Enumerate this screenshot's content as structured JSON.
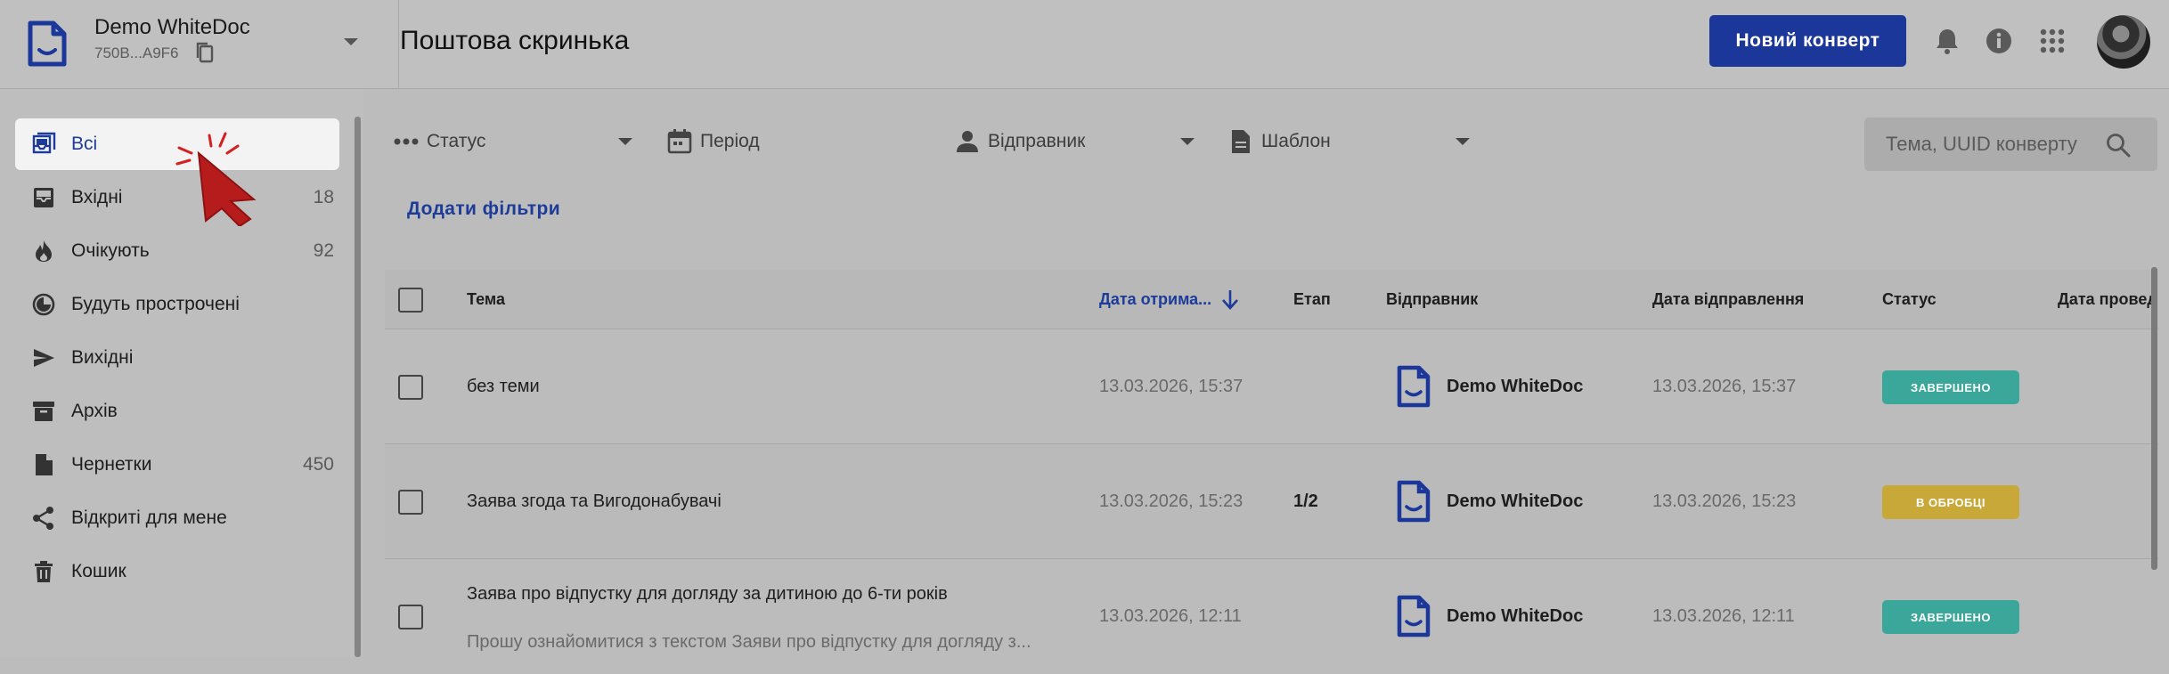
{
  "header": {
    "org_name": "Demo WhiteDoc",
    "org_id": "750B...A9F6",
    "page_title": "Поштова скринька",
    "new_envelope_label": "Новий конверт"
  },
  "colors": {
    "brand": "#1a3799",
    "status_done": "#3aa79a",
    "status_processing": "#c9a83a"
  },
  "sidebar": {
    "items": [
      {
        "label": "Всі",
        "count": "",
        "icon": "all-mail-icon",
        "active": true
      },
      {
        "label": "Вхідні",
        "count": "18",
        "icon": "inbox-icon"
      },
      {
        "label": "Очікують",
        "count": "92",
        "icon": "fire-icon"
      },
      {
        "label": "Будуть прострочені",
        "count": "",
        "icon": "clock-icon"
      },
      {
        "label": "Вихідні",
        "count": "",
        "icon": "send-icon"
      },
      {
        "label": "Архів",
        "count": "",
        "icon": "archive-icon"
      },
      {
        "label": "Чернетки",
        "count": "450",
        "icon": "draft-icon"
      },
      {
        "label": "Відкриті для мене",
        "count": "",
        "icon": "share-icon"
      },
      {
        "label": "Кошик",
        "count": "",
        "icon": "trash-icon"
      }
    ]
  },
  "filters": {
    "status": "Статус",
    "period": "Період",
    "sender": "Відправник",
    "template": "Шаблон",
    "search_placeholder": "Тема, UUID конверту",
    "add_filters": "Додати фільтри"
  },
  "table": {
    "columns": {
      "subject": "Тема",
      "received": "Дата отрима...",
      "stage": "Етап",
      "sender": "Відправник",
      "sent": "Дата відправлення",
      "status": "Статус",
      "processed": "Дата провед"
    },
    "rows": [
      {
        "subject": "без теми",
        "snippet": "",
        "received": "13.03.2026, 15:37",
        "stage": "",
        "sender": "Demo WhiteDoc",
        "sent": "13.03.2026, 15:37",
        "status": "ЗАВЕРШЕНО"
      },
      {
        "subject": "Заява згода та Вигодонабувачі",
        "snippet": "",
        "received": "13.03.2026, 15:23",
        "stage": "1/2",
        "sender": "Demo WhiteDoc",
        "sent": "13.03.2026, 15:23",
        "status": "В ОБРОБЦІ"
      },
      {
        "subject": "Заява про відпустку для догляду за дитиною до 6-ти років",
        "snippet": "Прошу ознайомитися з текстом Заяви про відпустку для догляду з...",
        "received": "13.03.2026, 12:11",
        "stage": "",
        "sender": "Demo WhiteDoc",
        "sent": "13.03.2026, 12:11",
        "status": "ЗАВЕРШЕНО"
      }
    ]
  }
}
